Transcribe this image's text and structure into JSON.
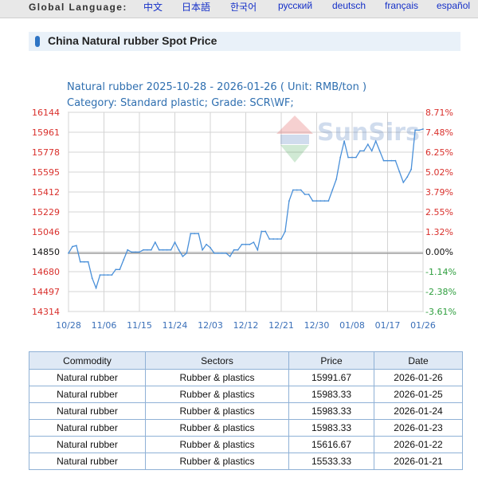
{
  "header": {
    "language_label": "Global Language:",
    "languages": [
      "中文",
      "日本語",
      "한국어",
      "русский",
      "deutsch",
      "français",
      "español"
    ]
  },
  "panel": {
    "title": "China Natural rubber Spot Price"
  },
  "watermark": {
    "brand": "SunSirs"
  },
  "chart_data": {
    "type": "line",
    "title": "Natural rubber 2025-10-28 - 2026-01-26  ( Unit: RMB/ton )",
    "subtitle": "Category: Standard plastic; Grade: SCR\\WF;",
    "x_tick_labels": [
      "10/28",
      "11/06",
      "11/15",
      "11/24",
      "12/03",
      "12/12",
      "12/21",
      "12/30",
      "01/08",
      "01/17",
      "01/26"
    ],
    "left_axis_labels": [
      "16144",
      "15961",
      "15778",
      "15595",
      "15412",
      "15229",
      "15046",
      "14850",
      "14680",
      "14497",
      "14314"
    ],
    "right_axis_labels": [
      "8.71%",
      "7.48%",
      "6.25%",
      "5.02%",
      "3.79%",
      "2.55%",
      "1.32%",
      "0.00%",
      "-1.14%",
      "-2.38%",
      "-3.61%"
    ],
    "ylim": [
      14314,
      16144
    ],
    "baseline": 14850,
    "series": [
      {
        "color": "#4a90d9",
        "x": [
          "10/28",
          "10/29",
          "10/30",
          "10/31",
          "11/01",
          "11/02",
          "11/03",
          "11/04",
          "11/05",
          "11/06",
          "11/07",
          "11/08",
          "11/09",
          "11/10",
          "11/11",
          "11/12",
          "11/13",
          "11/14",
          "11/15",
          "11/16",
          "11/17",
          "11/18",
          "11/19",
          "11/20",
          "11/21",
          "11/22",
          "11/23",
          "11/24",
          "11/25",
          "11/26",
          "11/27",
          "11/28",
          "11/29",
          "11/30",
          "12/01",
          "12/02",
          "12/03",
          "12/04",
          "12/05",
          "12/06",
          "12/07",
          "12/08",
          "12/09",
          "12/10",
          "12/11",
          "12/12",
          "12/13",
          "12/14",
          "12/15",
          "12/16",
          "12/17",
          "12/18",
          "12/19",
          "12/20",
          "12/21",
          "12/22",
          "12/23",
          "12/24",
          "12/25",
          "12/26",
          "12/27",
          "12/28",
          "12/29",
          "12/30",
          "12/31",
          "01/01",
          "01/02",
          "01/03",
          "01/04",
          "01/05",
          "01/06",
          "01/07",
          "01/08",
          "01/09",
          "01/10",
          "01/11",
          "01/12",
          "01/13",
          "01/14",
          "01/15",
          "01/16",
          "01/17",
          "01/18",
          "01/19",
          "01/20",
          "01/21",
          "01/22",
          "01/23",
          "01/24",
          "01/25",
          "01/26"
        ],
        "values": [
          14850,
          14910,
          14920,
          14770,
          14770,
          14770,
          14620,
          14530,
          14650,
          14650,
          14650,
          14650,
          14700,
          14700,
          14790,
          14880,
          14860,
          14860,
          14860,
          14880,
          14880,
          14880,
          14950,
          14880,
          14880,
          14880,
          14880,
          14950,
          14880,
          14820,
          14850,
          15030,
          15030,
          15030,
          14880,
          14930,
          14900,
          14850,
          14850,
          14850,
          14850,
          14820,
          14880,
          14880,
          14930,
          14930,
          14930,
          14950,
          14880,
          15050,
          15050,
          14980,
          14980,
          14980,
          14980,
          15050,
          15330,
          15430,
          15430,
          15430,
          15390,
          15390,
          15330,
          15330,
          15330,
          15330,
          15330,
          15430,
          15530,
          15730,
          15880,
          15730,
          15730,
          15730,
          15790,
          15790,
          15850,
          15790,
          15880,
          15790,
          15700,
          15700,
          15700,
          15700,
          15600,
          15500,
          15550,
          15620,
          15980,
          15980,
          15990
        ]
      }
    ]
  },
  "table": {
    "headers": [
      "Commodity",
      "Sectors",
      "Price",
      "Date"
    ],
    "rows": [
      [
        "Natural rubber",
        "Rubber & plastics",
        "15991.67",
        "2026-01-26"
      ],
      [
        "Natural rubber",
        "Rubber & plastics",
        "15983.33",
        "2026-01-25"
      ],
      [
        "Natural rubber",
        "Rubber & plastics",
        "15983.33",
        "2026-01-24"
      ],
      [
        "Natural rubber",
        "Rubber & plastics",
        "15983.33",
        "2026-01-23"
      ],
      [
        "Natural rubber",
        "Rubber & plastics",
        "15616.67",
        "2026-01-22"
      ],
      [
        "Natural rubber",
        "Rubber & plastics",
        "15533.33",
        "2026-01-21"
      ]
    ]
  },
  "colors": {
    "title_blue": "#2f6fb0",
    "left_axis_red": "#d9302c",
    "right_axis_red": "#d9302c",
    "right_axis_green": "#2e9e3e",
    "x_axis_blue": "#3a6fb8",
    "line_blue": "#4a90d9",
    "panel_accent": "#2e74c4"
  }
}
